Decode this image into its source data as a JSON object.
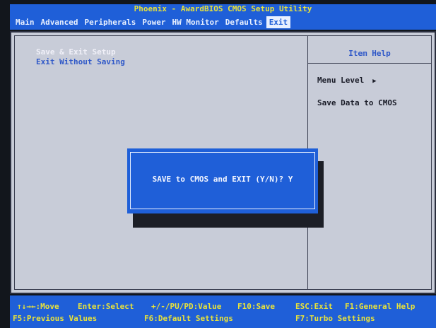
{
  "title": "Phoenix - AwardBIOS CMOS Setup Utility",
  "menu": [
    {
      "label": "Main",
      "active": false
    },
    {
      "label": "Advanced",
      "active": false
    },
    {
      "label": "Peripherals",
      "active": false
    },
    {
      "label": "Power",
      "active": false
    },
    {
      "label": "HW Monitor",
      "active": false
    },
    {
      "label": "Defaults",
      "active": false
    },
    {
      "label": "Exit",
      "active": true
    }
  ],
  "options": [
    {
      "label": "Save & Exit Setup",
      "selected": true
    },
    {
      "label": "Exit Without Saving",
      "selected": false
    }
  ],
  "help": {
    "title": "Item Help",
    "menu_level": "Menu Level",
    "menu_level_icon": "right-triangle-icon",
    "description": "Save Data to CMOS"
  },
  "dialog": {
    "prompt": "SAVE to CMOS and EXIT (Y/N)? Y"
  },
  "footer": {
    "move": "↑↓→←:Move",
    "enter": "Enter:Select",
    "value": "+/-/PU/PD:Value",
    "save": "F10:Save",
    "exit": "ESC:Exit",
    "help": "F1:General Help",
    "prev": "F5:Previous Values",
    "defaults": "F6:Default Settings",
    "turbo": "F7:Turbo Settings"
  },
  "colors": {
    "bios_blue": "#1f5fd8",
    "panel_gray": "#c8ccd8",
    "title_yellow": "#e8e23a",
    "option_blue": "#2f58c8"
  }
}
